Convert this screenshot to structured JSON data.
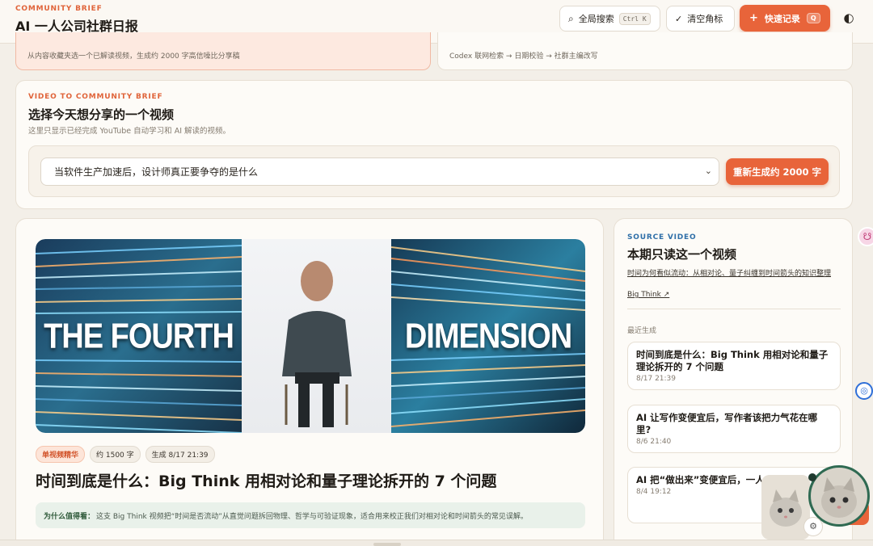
{
  "header": {
    "kicker": "COMMUNITY BRIEF",
    "title": "AI 一人公司社群日报",
    "search_label": "全局搜索",
    "search_kbd": "Ctrl K",
    "clear_label": "清空角标",
    "quick_label": "快速记录",
    "quick_kbd": "Q",
    "search_icon": "⌕",
    "clear_icon": "✓",
    "quick_icon": "+",
    "theme_icon": "◐"
  },
  "strip": {
    "left_text": "从内容收藏夹选一个已解读视频，生成约 2000 字高信噪比分享稿",
    "right_text": "Codex 联网检索 → 日期校验 → 社群主编改写"
  },
  "selector": {
    "kicker": "VIDEO TO COMMUNITY BRIEF",
    "title": "选择今天想分享的一个视频",
    "subtitle": "这里只显示已经完成 YouTube 自动学习和 AI 解读的视频。",
    "selected": "当软件生产加速后，设计师真正要争夺的是什么",
    "chevron": "⌄",
    "regen_label": "重新生成约 2000 字"
  },
  "article": {
    "hero_left_text": "THE FOURTH",
    "hero_right_text": "DIMENSION",
    "chips": [
      "单视频精华",
      "约 1500 字",
      "生成 8/17 21:39"
    ],
    "title": "时间到底是什么：Big Think 用相对论和量子理论拆开的 7 个问题",
    "why_label": "为什么值得看：",
    "why_text": "这支 Big Think 视频把“时间是否流动”从直觉问题拆回物理、哲学与可验证现象，适合用来校正我们对相对论和时间箭头的常见误解。"
  },
  "sidebar": {
    "kicker": "SOURCE VIDEO",
    "title": "本期只读这一个视频",
    "video_link": "时间为何看似流动：从相对论、量子纠缠到时间箭头的知识整理",
    "source_link": "Big Think ↗",
    "recent_label": "最近生成",
    "recent": [
      {
        "title": "时间到底是什么：Big Think 用相对论和量子理论拆开的 7 个问题",
        "time": "8/17 21:39"
      },
      {
        "title": "AI 让写作变便宜后，写作者该把力气花在哪里?",
        "time": "8/6 21:40"
      },
      {
        "title": "AI 把“做出来”变便宜后，一人…么?",
        "time": "8/4 19:12"
      }
    ]
  },
  "floaters": {
    "pink_icon": "☋",
    "blue_icon": "◎",
    "gear_icon": "⚙"
  },
  "colors": {
    "accent": "#e8643a",
    "background": "#f3efe8",
    "card": "#fdfbf7",
    "link_blue": "#2f6fa8"
  }
}
